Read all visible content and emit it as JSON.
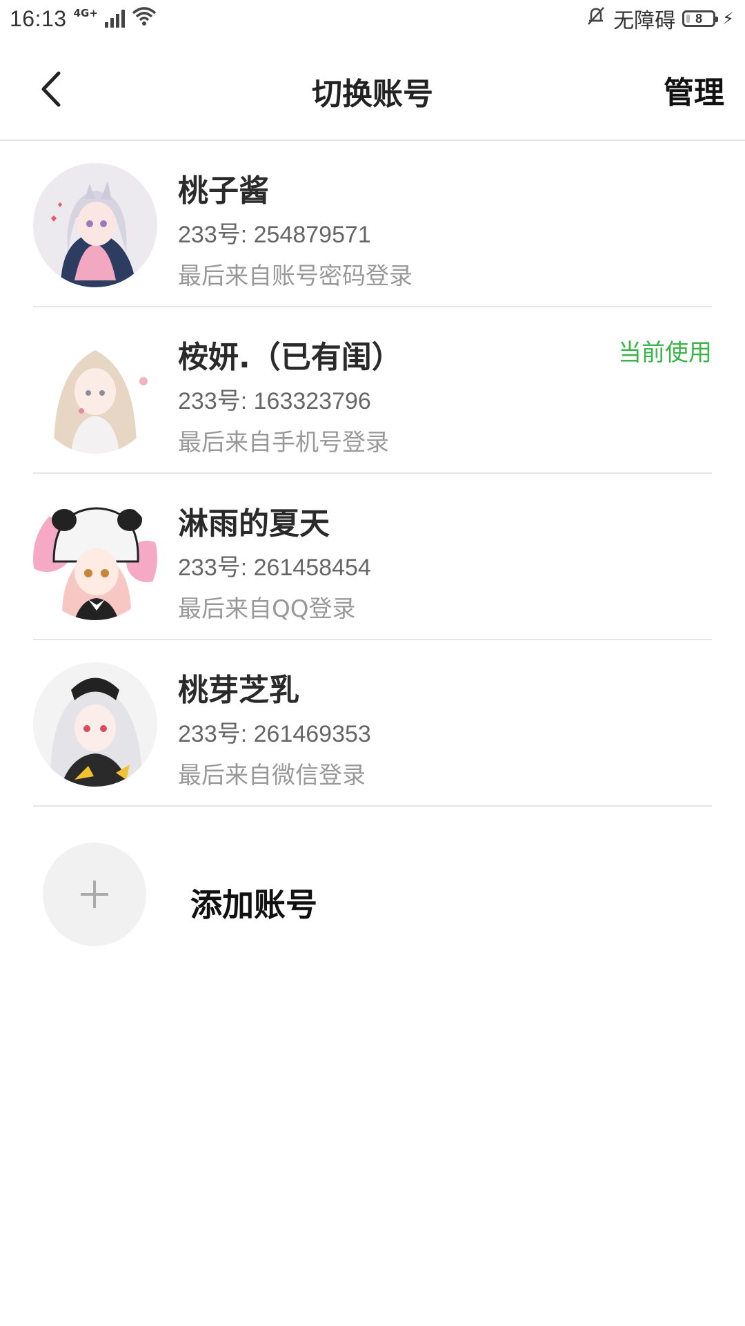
{
  "status_bar": {
    "time": "16:13",
    "network": "4G+",
    "accessibility_text": "无障碍",
    "battery_level": "8",
    "icons": [
      "signal-icon",
      "wifi-icon",
      "silent-bell-icon",
      "battery-icon",
      "charging-bolt-icon"
    ]
  },
  "header": {
    "back_icon": "chevron-left-icon",
    "title": "切换账号",
    "manage_label": "管理"
  },
  "accounts": [
    {
      "name": "桃子酱",
      "id_text": "233号: 254879571",
      "login_text": "最后来自账号密码登录",
      "current_label": ""
    },
    {
      "name": "桉妍.（已有闺）",
      "id_text": "233号: 163323796",
      "login_text": "最后来自手机号登录",
      "current_label": "当前使用"
    },
    {
      "name": "淋雨的夏天",
      "id_text": "233号: 261458454",
      "login_text": "最后来自QQ登录",
      "current_label": ""
    },
    {
      "name": "桃芽芝乳",
      "id_text": "233号: 261469353",
      "login_text": "最后来自微信登录",
      "current_label": ""
    }
  ],
  "add_account": {
    "label": "添加账号",
    "icon": "plus-icon"
  },
  "colors": {
    "current_badge": "#3cb44b",
    "divider": "#e6e6e6",
    "add_circle_bg": "#f1f1f1"
  }
}
